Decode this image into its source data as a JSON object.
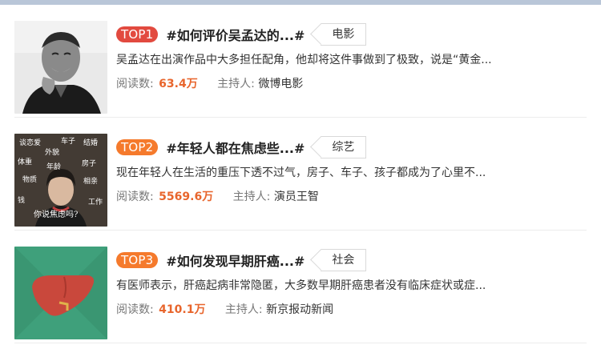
{
  "items": [
    {
      "rank": "TOP1",
      "title": "#如何评价吴孟达的...#",
      "category": "电影",
      "description": "吴孟达在出演作品中大多担任配角，他却将这件事做到了极致，说是“黄金...",
      "read_label": "阅读数:",
      "read_count": "63.4万",
      "host_label": "主持人:",
      "host": "微博电影",
      "thumb_icon": "portrait-photo"
    },
    {
      "rank": "TOP2",
      "title": "#年轻人都在焦虑些...#",
      "category": "综艺",
      "description": "现在年轻人在生活的重压下透不过气，房子、车子、孩子都成为了心里不...",
      "read_label": "阅读数:",
      "read_count": "5569.6万",
      "host_label": "主持人:",
      "host": "演员王智",
      "thumb_icon": "anxiety-words-photo",
      "thumb_words": [
        "谈恋爱",
        "车子",
        "结婚",
        "外貌",
        "体重",
        "年龄",
        "房子",
        "物质",
        "相亲",
        "钱",
        "工作",
        "你说焦虑吗?"
      ]
    },
    {
      "rank": "TOP3",
      "title": "#如何发现早期肝癌...#",
      "category": "社会",
      "description": "有医师表示，肝癌起病非常隐匿，大多数早期肝癌患者没有临床症状或症...",
      "read_label": "阅读数:",
      "read_count": "410.1万",
      "host_label": "主持人:",
      "host": "新京报动新闻",
      "thumb_icon": "liver-icon"
    }
  ],
  "colors": {
    "top1_badge": "#e24a3f",
    "top2_badge": "#f57a2c",
    "count_accent": "#e8652c",
    "liver_bg": "#3fa07b",
    "liver": "#c9483c"
  }
}
